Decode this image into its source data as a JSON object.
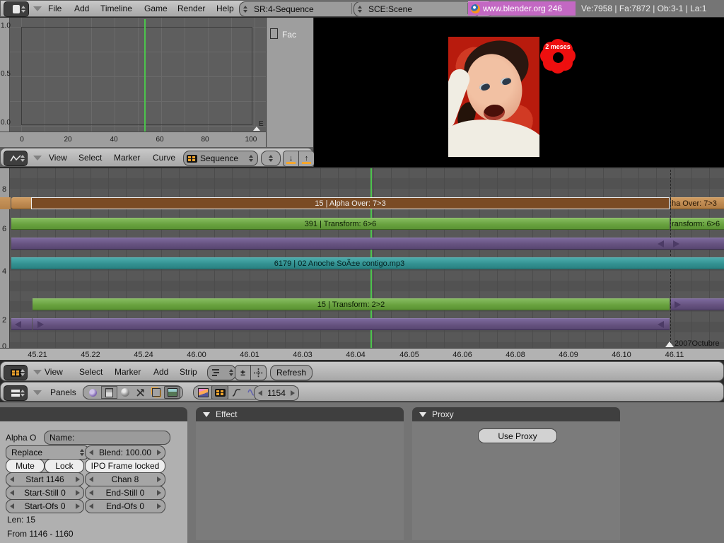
{
  "colors": {
    "strip_orange_selected": "#7a4b24",
    "strip_orange": "#bd8950",
    "strip_green": "#69a23f",
    "strip_purple": "#665380",
    "strip_teal": "#339191",
    "playhead_green": "#4cc44c",
    "link_badge_pink": "#c368c3",
    "flower_red": "#ee0f0f",
    "panel_header_gray": "#3f3f3f"
  },
  "glyphs": {
    "close": "×"
  },
  "header": {
    "menus": [
      "File",
      "Add",
      "Timeline",
      "Game",
      "Render",
      "Help"
    ],
    "screen_combo": "SR:4-Sequence",
    "scene_combo": "SCE:Scene",
    "link_badge": "www.blender.org 246",
    "stats": "Ve:7958 | Fa:7872 | Ob:3-1 | La:1"
  },
  "ipo_editor": {
    "y_ticks": [
      "1.0",
      "0.5",
      "0.0"
    ],
    "x_ticks": [
      "0",
      "20",
      "40",
      "60",
      "80",
      "100"
    ],
    "channel": "Fac",
    "end_marker": "E",
    "header": {
      "menus": [
        "View",
        "Select",
        "Marker",
        "Curve"
      ],
      "ipo_type": "Sequence"
    }
  },
  "preview": {
    "sticker_text": "2 meses"
  },
  "sequencer": {
    "channels": [
      "8",
      "6",
      "4",
      "2",
      "0"
    ],
    "strips": {
      "alpha_over_selected": "15 | Alpha Over: 7>3",
      "alpha_over_clipped": "ha Over: 7>3",
      "transform6": "391 | Transform: 6>6",
      "transform6_clipped": "ransform: 6>6",
      "audio": "6179 | 02 Anoche SoÃ±e contigo.mp3",
      "transform2": "15 | Transform: 2>2"
    },
    "timeline_ticks": [
      "45.21",
      "45.22",
      "45.24",
      "46.00",
      "46.01",
      "46.03",
      "46.04",
      "46.05",
      "46.06",
      "46.08",
      "46.09",
      "46.10",
      "46.11"
    ],
    "marker": "2007Octubre",
    "header": {
      "menus": [
        "View",
        "Select",
        "Marker",
        "Add",
        "Strip"
      ],
      "refresh_button": "Refresh"
    }
  },
  "buttons_window": {
    "header": {
      "panels_label": "Panels",
      "frame_number": "1154"
    },
    "edit_panel": {
      "strip_type": "Alpha O",
      "name_field": "Name:",
      "blend_mode": "Replace",
      "blend_value": "Blend: 100.00",
      "mute": "Mute",
      "lock": "Lock",
      "ipo_frame_locked": "IPO Frame locked",
      "start": "Start 1146",
      "channel": "Chan 8",
      "start_still": "Start-Still 0",
      "end_still": "End-Still 0",
      "start_ofs": "Start-Ofs 0",
      "end_ofs": "End-Ofs 0",
      "length": "Len: 15",
      "range": "From 1146 - 1160"
    },
    "effect_panel": {
      "title": "Effect"
    },
    "proxy_panel": {
      "title": "Proxy",
      "use_proxy_button": "Use Proxy"
    }
  }
}
